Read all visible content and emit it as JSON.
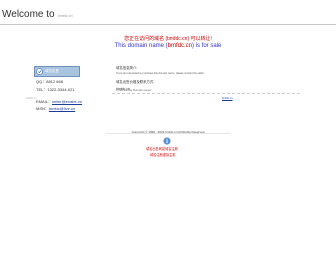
{
  "header": {
    "welcome": "Welcome to",
    "domain_small": "bmfdc.cn"
  },
  "notice": {
    "line1_prefix": "您正在访问的域名 (",
    "line1_domain": "bmfdc.cn",
    "line1_suffix": ") 可以转让!",
    "line2_prefix": "This domain name (",
    "line2_domain": "bmfdc.cn",
    "line2_suffix": ") is for sale"
  },
  "contact": {
    "sale_banner": "域名出售",
    "qq_label": "QQ：",
    "qq_value": "8812 668",
    "tel_label": "TEL：",
    "tel_value": "1322-3344-021",
    "email_label": "EMAIL：",
    "email_value": "seller@enabe.cn",
    "msn_label": "MSN：",
    "msn_value": "bmfdc@live.cn"
  },
  "panel": {
    "title": "域名信息简介:",
    "desc": "If you are interested to purchase this domain name, please contact the seller.",
    "seller_title": "域名出售价格及联系方式:",
    "seller_name": "bmfdc.cn",
    "biz_msg": "If you are the Domain owner"
  },
  "footer": {
    "domain_left": "bmfdc.cn",
    "domain_right": "bmfdc.cn",
    "copyright": "Copyright © 1999 - 2023 bmfdc.cn All Rights Reserved",
    "link_a": "域名出售网站域名注册",
    "link_b": "域名注册虚拟主机"
  }
}
